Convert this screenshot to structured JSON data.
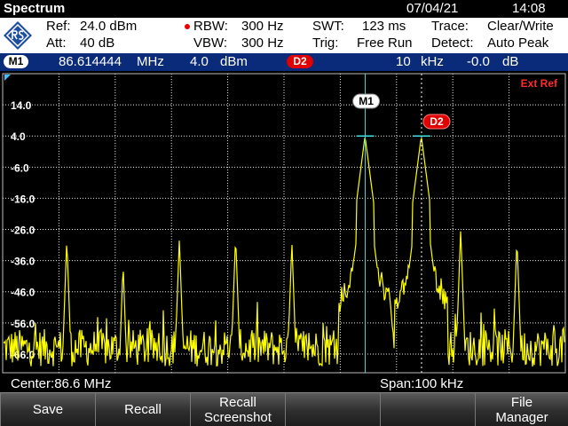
{
  "title_bar": {
    "app_name": "Spectrum",
    "date": "07/04/21",
    "time": "14:08"
  },
  "settings": {
    "ref": "Ref:",
    "ref_value": "24.0 dBm",
    "att": "Att:",
    "att_value": "40 dB",
    "rbw": "RBW:",
    "rbw_value": "300 Hz",
    "vbw": "VBW:",
    "vbw_value": "300 Hz",
    "swt": "SWT:",
    "swt_value": "123 ms",
    "trig": "Trig:",
    "trig_value": "Free Run",
    "trace": "Trace:",
    "trace_value": "Clear/Write",
    "detect": "Detect:",
    "detect_value": "Auto Peak"
  },
  "marker_bar": {
    "m1_label": "M1",
    "m1_freq": "86.614444",
    "m1_freq_unit": "MHz",
    "m1_level": "4.0",
    "m1_level_unit": "dBm",
    "d2_label": "D2",
    "d2_freq": "10",
    "d2_freq_unit": "kHz",
    "d2_level": "-0.0",
    "d2_level_unit": "dB"
  },
  "plot": {
    "ext_ref": "Ext Ref",
    "y_labels": [
      "14.0",
      "4.0",
      "-6.0",
      "-16.0",
      "-26.0",
      "-36.0",
      "-46.0",
      "-56.0",
      "-66.0"
    ],
    "marker_m1": "M1",
    "marker_d2": "D2",
    "trace_color": "#ffff00",
    "marker_line_color": "#40e0e0"
  },
  "chart_data": {
    "type": "line",
    "x_unit": "MHz",
    "y_unit": "dBm",
    "xlim": [
      86.55,
      86.65
    ],
    "ylim": [
      -72,
      24
    ],
    "noise_floor": -64,
    "peaks": [
      {
        "x": 86.5614,
        "y": -29
      },
      {
        "x": 86.5714,
        "y": -37
      },
      {
        "x": 86.5814,
        "y": -29
      },
      {
        "x": 86.5914,
        "y": -28
      },
      {
        "x": 86.6014,
        "y": -30
      },
      {
        "x": 86.6144,
        "y": 4
      },
      {
        "x": 86.6244,
        "y": 4
      },
      {
        "x": 86.6314,
        "y": -26
      },
      {
        "x": 86.6414,
        "y": -29
      }
    ],
    "markers": [
      {
        "name": "M1",
        "x": 86.614444,
        "y": 4.0
      },
      {
        "name": "D2",
        "x": 86.624444,
        "y": 4.0
      }
    ]
  },
  "span_bar": {
    "center": "Center:86.6 MHz",
    "span": "Span:100 kHz"
  },
  "softkeys": [
    {
      "line1": "Save",
      "line2": ""
    },
    {
      "line1": "Recall",
      "line2": ""
    },
    {
      "line1": "Recall",
      "line2": "Screenshot"
    },
    {
      "line1": "",
      "line2": ""
    },
    {
      "line1": "",
      "line2": ""
    },
    {
      "line1": "File",
      "line2": "Manager"
    }
  ]
}
